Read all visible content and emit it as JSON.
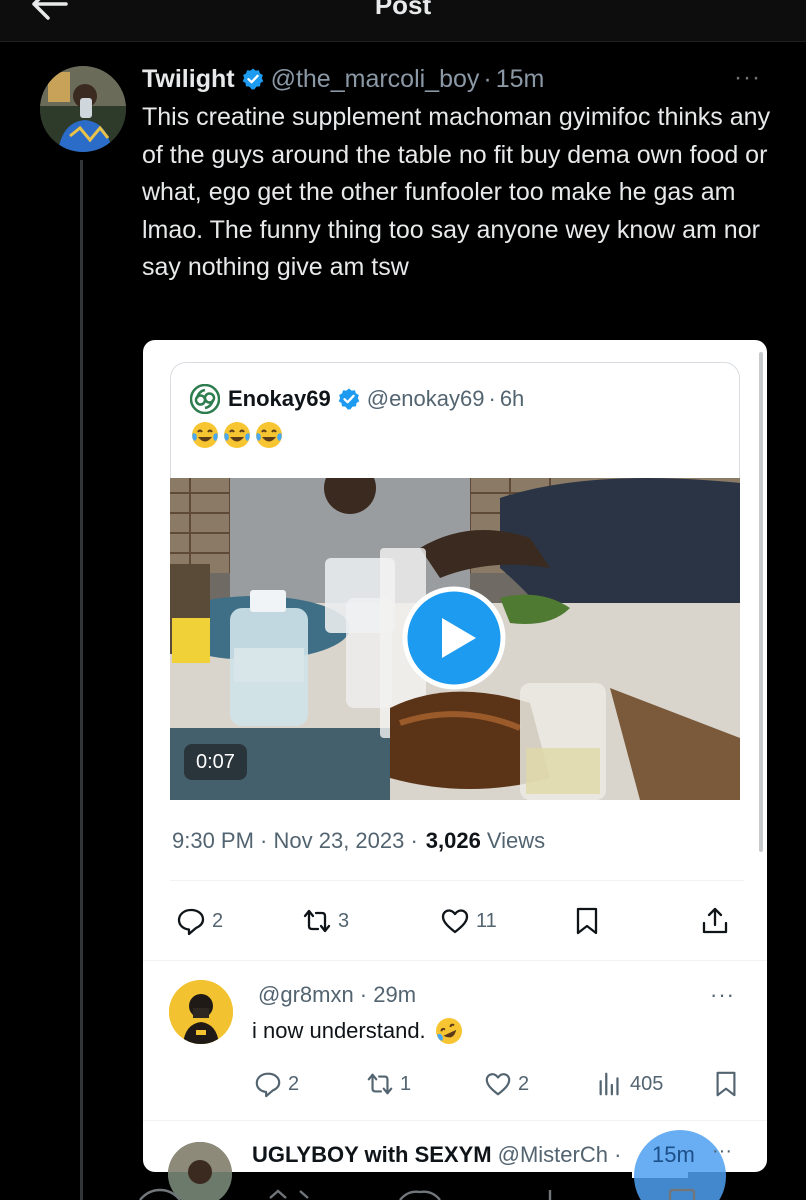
{
  "header": {
    "title": "Post"
  },
  "tweet": {
    "name": "Twilight",
    "handle": "@the_marcoli_boy",
    "dot": "·",
    "time": "15m",
    "more": "···",
    "text": "This creatine supplement machoman gyimifoc thinks any of the guys around the table no fit buy dema own food or what, ego get the other funfooler too make he gas am lmao. The funny thing too say anyone wey know am nor say nothing give am tsw"
  },
  "quoted": {
    "name": "Enokay69",
    "handle": "@enokay69",
    "dot": "·",
    "time": "6h",
    "emoji_count": 3,
    "duration": "0:07",
    "timestamp": "9:30 PM · Nov 23, 2023 ·",
    "views_count": "3,026",
    "views_label": "Views",
    "actions": {
      "replies": "2",
      "reposts": "3",
      "likes": "11"
    }
  },
  "replies": [
    {
      "handle_time": "@gr8mxn · 29m",
      "more": "···",
      "text": "i now understand.",
      "actions": {
        "replies": "2",
        "reposts": "1",
        "likes": "2",
        "views": "405"
      }
    },
    {
      "name": "UGLYBOY with SEXYM",
      "handle": "@MisterCh ·",
      "time": "15m",
      "more": "···"
    }
  ],
  "colors": {
    "background": "#000000",
    "accent": "#1d9bf0",
    "card": "#ffffff",
    "muted": "#536471"
  }
}
